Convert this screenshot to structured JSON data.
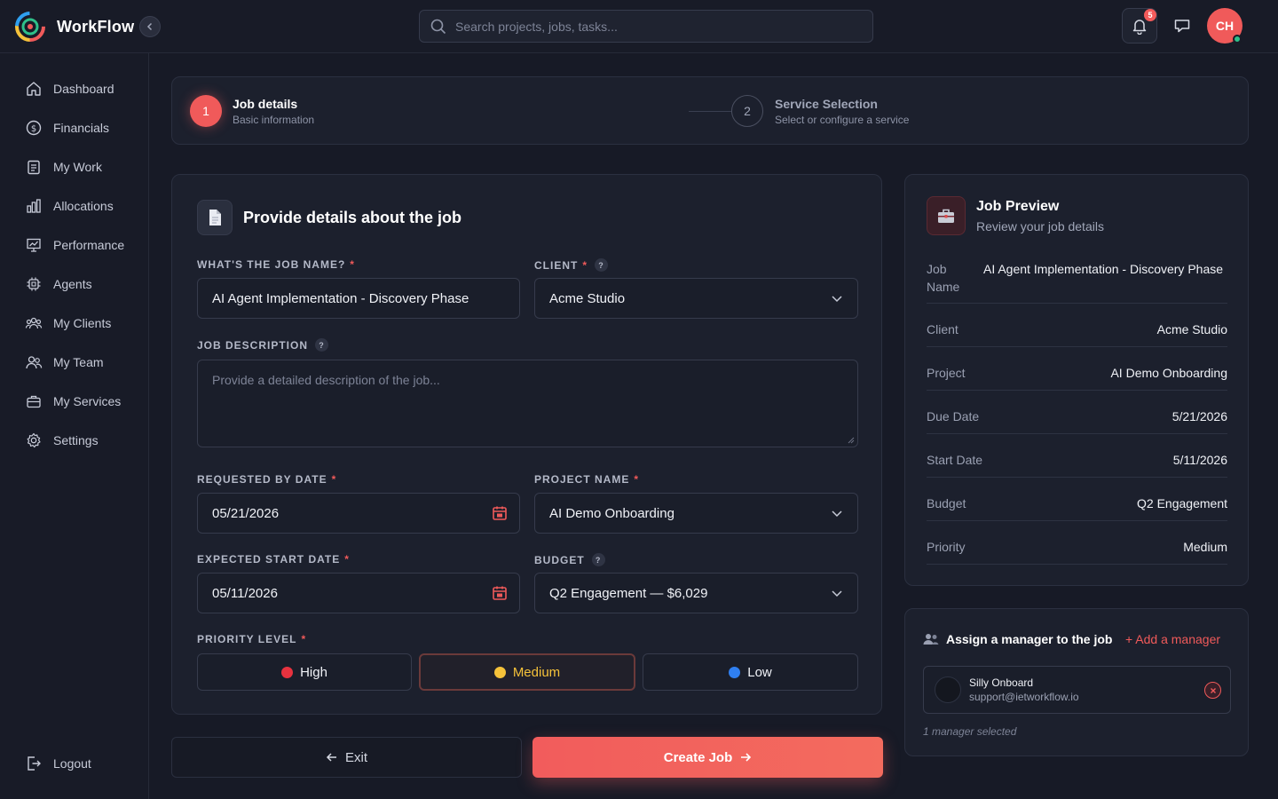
{
  "app": {
    "name": "WorkFlow"
  },
  "search": {
    "placeholder": "Search projects, jobs, tasks..."
  },
  "header": {
    "notifications_count": "5",
    "avatar_initials": "CH"
  },
  "sidebar": {
    "items": [
      {
        "label": "Dashboard",
        "icon": "home-icon"
      },
      {
        "label": "Financials",
        "icon": "dollar-icon"
      },
      {
        "label": "My Work",
        "icon": "clipboard-icon"
      },
      {
        "label": "Allocations",
        "icon": "bar-chart-icon"
      },
      {
        "label": "Performance",
        "icon": "presentation-chart-icon"
      },
      {
        "label": "Agents",
        "icon": "chip-icon"
      },
      {
        "label": "My Clients",
        "icon": "users-group-icon"
      },
      {
        "label": "My Team",
        "icon": "users-icon"
      },
      {
        "label": "My Services",
        "icon": "briefcase-icon"
      },
      {
        "label": "Settings",
        "icon": "gear-icon"
      }
    ],
    "logout_label": "Logout"
  },
  "stepper": {
    "steps": [
      {
        "number": "1",
        "title": "Job details",
        "subtitle": "Basic information"
      },
      {
        "number": "2",
        "title": "Service Selection",
        "subtitle": "Select or configure a service"
      }
    ]
  },
  "form": {
    "title": "Provide details about the job",
    "job_name": {
      "label": "WHAT'S THE JOB NAME?",
      "value": "AI Agent Implementation - Discovery Phase"
    },
    "client": {
      "label": "CLIENT",
      "value": "Acme Studio"
    },
    "description": {
      "label": "JOB DESCRIPTION",
      "placeholder": "Provide a detailed description of the job..."
    },
    "requested_by": {
      "label": "REQUESTED BY DATE",
      "value": "05/21/2026"
    },
    "project_name": {
      "label": "PROJECT NAME",
      "value": "AI Demo Onboarding"
    },
    "start_date": {
      "label": "EXPECTED START DATE",
      "value": "05/11/2026"
    },
    "budget": {
      "label": "BUDGET",
      "value": "Q2 Engagement — $6,029"
    },
    "priority": {
      "label": "PRIORITY LEVEL",
      "options": [
        {
          "label": "High",
          "color": "#e8323f"
        },
        {
          "label": "Medium",
          "color": "#f5c23a"
        },
        {
          "label": "Low",
          "color": "#2f7ff0"
        }
      ],
      "selected": "Medium"
    },
    "required_mark": "*",
    "help_mark": "?"
  },
  "actions": {
    "exit_label": "Exit",
    "create_label": "Create Job"
  },
  "preview": {
    "title": "Job Preview",
    "subtitle": "Review your job details",
    "rows": [
      {
        "key": "Job Name",
        "value": "AI Agent Implementation - Discovery Phase"
      },
      {
        "key": "Client",
        "value": "Acme Studio"
      },
      {
        "key": "Project",
        "value": "AI Demo Onboarding"
      },
      {
        "key": "Due Date",
        "value": "5/21/2026"
      },
      {
        "key": "Start Date",
        "value": "5/11/2026"
      },
      {
        "key": "Budget",
        "value": "Q2 Engagement"
      },
      {
        "key": "Priority",
        "value": "Medium"
      }
    ]
  },
  "manager": {
    "title": "Assign a manager to the job",
    "add_label": "+ Add a manager",
    "selected": {
      "name": "Silly Onboard",
      "email": "support@ietworkflow.io"
    },
    "count_text": "1 manager selected"
  },
  "colors": {
    "accent": "#f05a5a",
    "background": "#171a26",
    "card": "#1c202d"
  }
}
